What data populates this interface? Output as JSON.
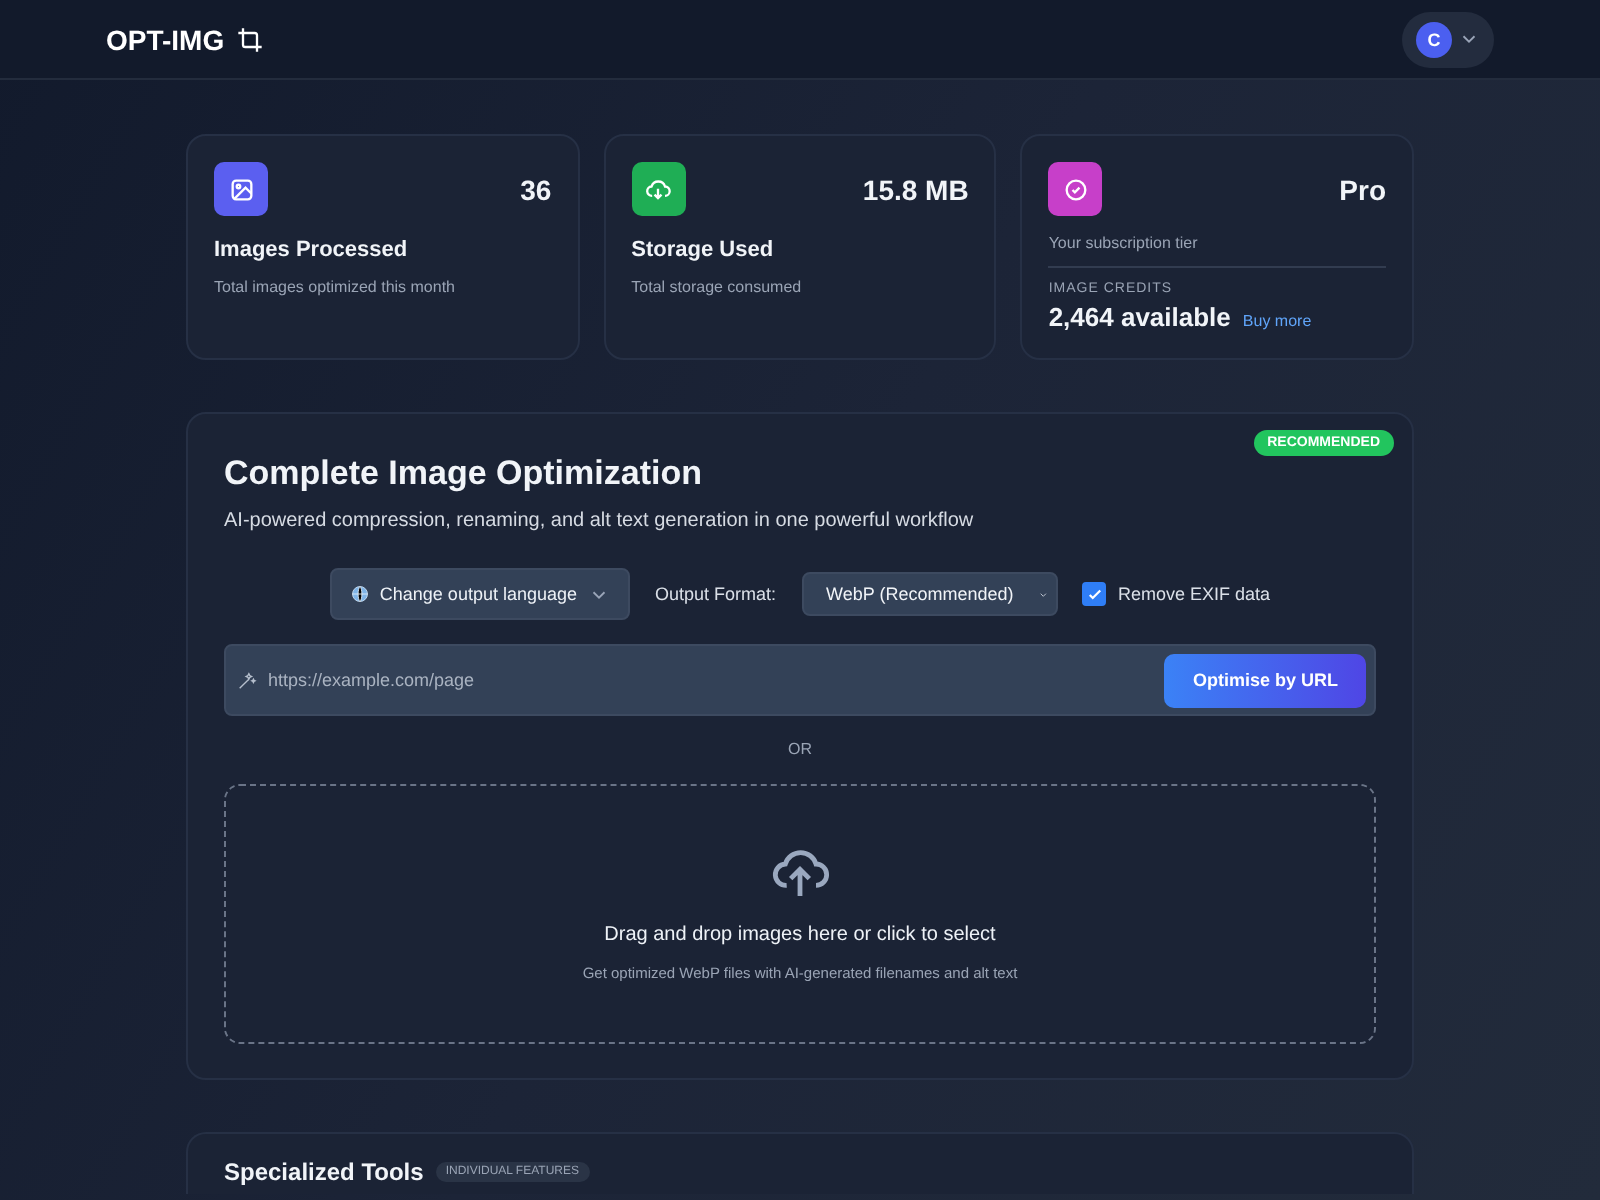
{
  "header": {
    "logo": "OPT-IMG",
    "avatar_initial": "C"
  },
  "stats": [
    {
      "kind": "stat",
      "color": "#5b5ff0",
      "value": "36",
      "title": "Images Processed",
      "caption": "Total images optimized this month"
    },
    {
      "kind": "stat",
      "color": "#1fae55",
      "value": "15.8 MB",
      "title": "Storage Used",
      "caption": "Total storage consumed"
    },
    {
      "kind": "plan",
      "color": "#c73fc9",
      "value": "Pro",
      "caption": "Your subscription tier",
      "credits_label": "IMAGE CREDITS",
      "credits": "2,464 available",
      "link": "Buy more"
    }
  ],
  "main": {
    "badge": "RECOMMENDED",
    "title": "Complete Image Optimization",
    "subtitle": "AI-powered compression, renaming, and alt text generation in one powerful workflow",
    "language_button": "Change output language",
    "format_label": "Output Format:",
    "format_value": "WebP (Recommended)",
    "exif": {
      "label": "Remove EXIF data",
      "checked": true
    },
    "url_placeholder": "https://example.com/page",
    "url_button": "Optimise by URL",
    "divider": "OR",
    "drop_title": "Drag and drop images here or click to select",
    "drop_caption": "Get optimized WebP files with AI-generated filenames and alt text"
  },
  "tools": {
    "title": "Specialized Tools",
    "badge": "INDIVIDUAL FEATURES"
  }
}
